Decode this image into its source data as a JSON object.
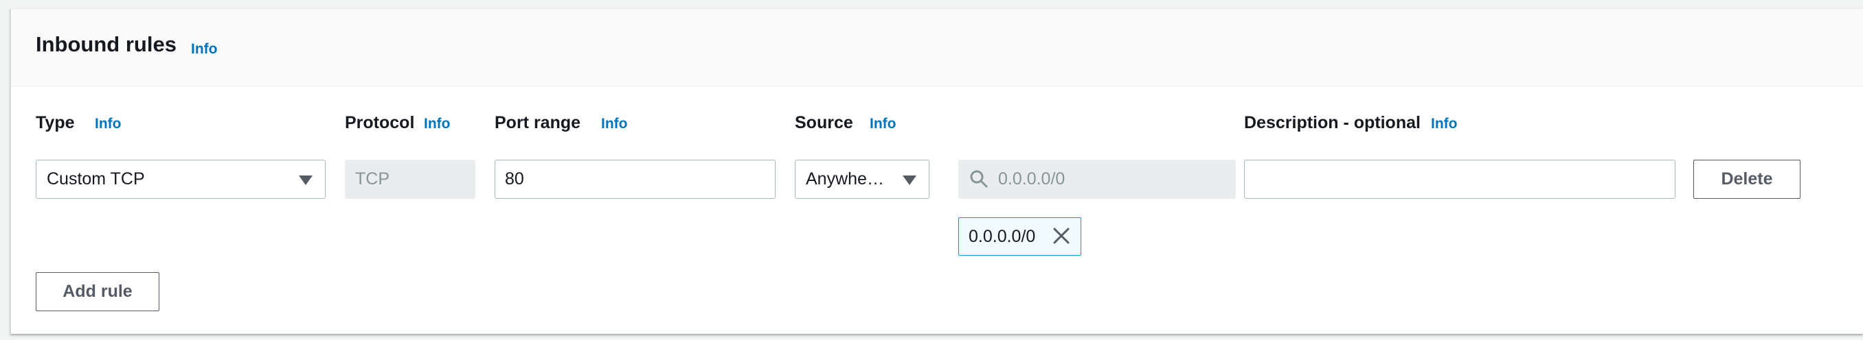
{
  "section": {
    "title": "Inbound rules",
    "info": "Info"
  },
  "columns": {
    "type": {
      "label": "Type",
      "info": "Info"
    },
    "protocol": {
      "label": "Protocol",
      "info": "Info"
    },
    "port_range": {
      "label": "Port range",
      "info": "Info"
    },
    "source": {
      "label": "Source",
      "info": "Info"
    },
    "description": {
      "label": "Description - optional",
      "info": "Info"
    }
  },
  "rule": {
    "type_value": "Custom TCP",
    "protocol_value": "TCP",
    "port_range_value": "80",
    "source_value": "Anywhe…",
    "cidr_placeholder": "0.0.0.0/0",
    "cidr_token": "0.0.0.0/0",
    "description_value": "",
    "delete_label": "Delete"
  },
  "actions": {
    "add_rule_label": "Add rule"
  },
  "icons": {
    "dropdown": "caret-down-icon",
    "search": "search-icon",
    "remove": "close-icon"
  },
  "colors": {
    "link": "#0073bb",
    "token_border": "#00a1c9",
    "token_bg": "#f1faff"
  }
}
